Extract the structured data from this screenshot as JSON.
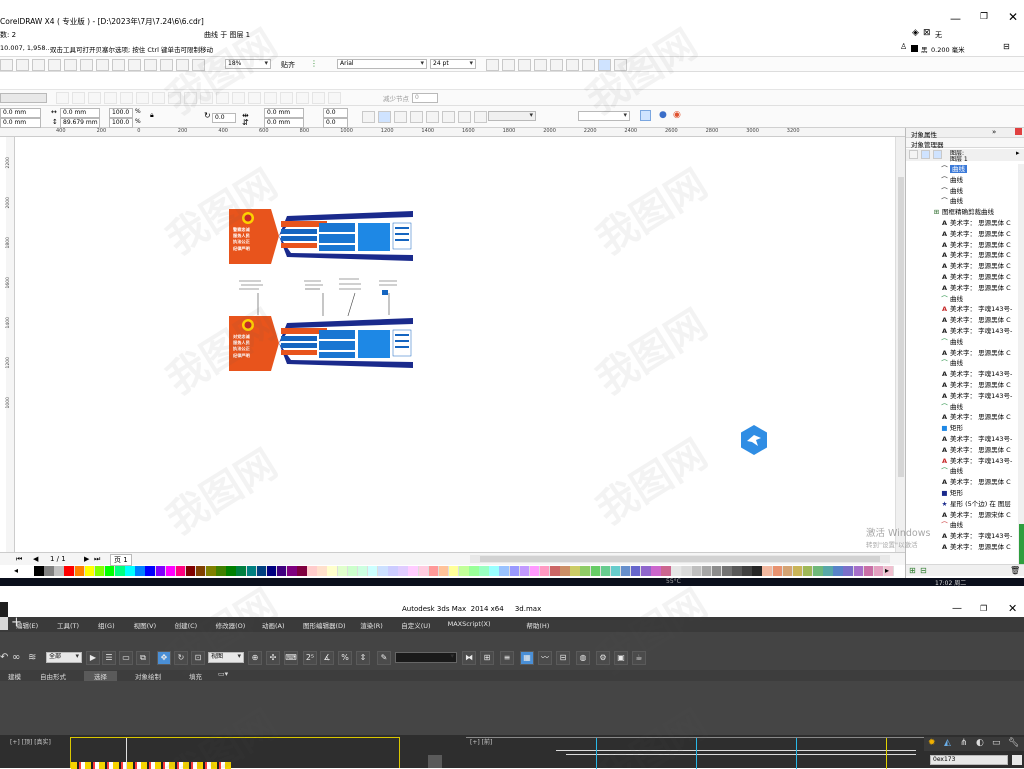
{
  "corel": {
    "title": "CorelDRAW X4 ( 专业版 ) - [D:\\2023年\\7月\\7.24\\6\\6.cdr]",
    "status_top": {
      "count": "数: 2",
      "object": "曲线 于 图层 1",
      "fill_none": "无"
    },
    "hint": {
      "coords": "10.007, 1,958... ",
      "text": "双击工具可打开贝塞尔选项; 按住 Ctrl 键单击可限制移动"
    },
    "outline": {
      "color_name": "黑",
      "width": "0.200 毫米"
    },
    "toolbar": {
      "zoom": "18%",
      "snap": "贴齐",
      "font": "Arial",
      "size": "24 pt"
    },
    "propbar": {
      "x": "0.0 mm",
      "y": "0.0 mm",
      "w": "0.0 mm",
      "h": "89.679 mm",
      "sx": "100.0",
      "sy": "100.0",
      "angle": "0.0",
      "p1": "0.0 mm",
      "p2": "0.0 mm",
      "o1": "0.0",
      "o2": "0.0",
      "reduce_nodes": "减少节点",
      "nodes_value": "0"
    },
    "ruler_ticks": [
      "400",
      "200",
      "0",
      "200",
      "400",
      "600",
      "800",
      "1000",
      "1200",
      "1400",
      "1600",
      "1800",
      "2000",
      "2200",
      "2400",
      "2600",
      "2800",
      "3000",
      "3200"
    ],
    "vruler_ticks": [
      "2200",
      "2000",
      "1800",
      "1600",
      "1400",
      "1200",
      "1000"
    ],
    "page_nav": {
      "counter": "1 / 1",
      "page_tab": "页 1"
    },
    "tray_time": "17:02 周二",
    "tray_temp": "55°C",
    "win_activate": {
      "line1": "激活 Windows",
      "line2": "转到\"设置\"以激活"
    },
    "docker": {
      "tab1": "对象属性",
      "tab2": "对象管理器",
      "layer_page": "图层:",
      "layer1": "图层 1",
      "items": [
        {
          "icon": "curve",
          "label": "曲线",
          "sel": true
        },
        {
          "icon": "curve",
          "label": "曲线"
        },
        {
          "icon": "curve",
          "label": "曲线"
        },
        {
          "icon": "curve",
          "label": "曲线"
        },
        {
          "icon": "clip",
          "label": "图框精确剪裁曲线"
        },
        {
          "icon": "text",
          "label": "美术字： 思源黑体 C"
        },
        {
          "icon": "text",
          "label": "美术字： 思源黑体 C"
        },
        {
          "icon": "text",
          "label": "美术字： 思源黑体 C"
        },
        {
          "icon": "text",
          "label": "美术字： 思源黑体 C"
        },
        {
          "icon": "text",
          "label": "美术字： 思源黑体 C"
        },
        {
          "icon": "text",
          "label": "美术字： 思源黑体 C"
        },
        {
          "icon": "text",
          "label": "美术字： 思源黑体 C"
        },
        {
          "icon": "curve-green",
          "label": "曲线"
        },
        {
          "icon": "text-red",
          "label": "美术字： 字魂143号-"
        },
        {
          "icon": "text",
          "label": "美术字： 思源黑体 C"
        },
        {
          "icon": "text",
          "label": "美术字： 字魂143号-"
        },
        {
          "icon": "curve-green",
          "label": "曲线"
        },
        {
          "icon": "text",
          "label": "美术字： 思源黑体 C"
        },
        {
          "icon": "curve-green",
          "label": "曲线"
        },
        {
          "icon": "text",
          "label": "美术字： 字魂143号-"
        },
        {
          "icon": "text",
          "label": "美术字： 思源黑体 C"
        },
        {
          "icon": "text",
          "label": "美术字： 字魂143号-"
        },
        {
          "icon": "curve-green",
          "label": "曲线"
        },
        {
          "icon": "text",
          "label": "美术字： 思源黑体 C"
        },
        {
          "icon": "rect-blue",
          "label": "矩形"
        },
        {
          "icon": "text",
          "label": "美术字： 字魂143号-"
        },
        {
          "icon": "text",
          "label": "美术字： 思源黑体 C"
        },
        {
          "icon": "text-red",
          "label": "美术字： 字魂143号-"
        },
        {
          "icon": "curve-green",
          "label": "曲线"
        },
        {
          "icon": "text",
          "label": "美术字： 思源黑体 C"
        },
        {
          "icon": "rect-navy",
          "label": "矩形"
        },
        {
          "icon": "star",
          "label": "星形 (5个边) 在 图层"
        },
        {
          "icon": "text",
          "label": "美术字： 思源宋体 C"
        },
        {
          "icon": "curve-red",
          "label": "曲线"
        },
        {
          "icon": "text",
          "label": "美术字： 字魂143号-"
        },
        {
          "icon": "text",
          "label": "美术字： 思源黑体 C"
        }
      ]
    },
    "design": {
      "panel1_text": "警察忠诚\n服务人民\n执法公正\n纪律严明",
      "panel2_text": "对党忠诚\n服务人民\n执法公正\n纪律严明",
      "accent_orange": "#e8541c",
      "accent_blue": "#1565c0",
      "navy": "#1a2a8c"
    },
    "palette": [
      "#ffffff",
      "#000000",
      "#808080",
      "#c0c0c0",
      "#ff0000",
      "#ff8000",
      "#ffff00",
      "#80ff00",
      "#00ff00",
      "#00ff80",
      "#00ffff",
      "#0080ff",
      "#0000ff",
      "#8000ff",
      "#ff00ff",
      "#ff0080",
      "#800000",
      "#804000",
      "#808000",
      "#408000",
      "#008000",
      "#008040",
      "#008080",
      "#004080",
      "#000080",
      "#400080",
      "#800080",
      "#800040",
      "#ffcccc",
      "#ffe0cc",
      "#ffffcc",
      "#e0ffcc",
      "#ccffcc",
      "#ccffe0",
      "#ccffff",
      "#cce0ff",
      "#ccccff",
      "#e0ccff",
      "#ffccff",
      "#ffcce0",
      "#ff9999",
      "#ffc299",
      "#ffff99",
      "#c2ff99",
      "#99ff99",
      "#99ffc2",
      "#99ffff",
      "#99c2ff",
      "#9999ff",
      "#c299ff",
      "#ff99ff",
      "#ff99c2",
      "#cc6666",
      "#cc8f66",
      "#cccc66",
      "#8fcc66",
      "#66cc66",
      "#66cc8f",
      "#66cccc",
      "#668fcc",
      "#6666cc",
      "#8f66cc",
      "#cc66cc",
      "#cc668f",
      "#e6e6e6",
      "#d9d9d9",
      "#bfbfbf",
      "#a6a6a6",
      "#8c8c8c",
      "#737373",
      "#595959",
      "#404040",
      "#262626",
      "#f2b8a0",
      "#e89270",
      "#d4a373",
      "#c9b458",
      "#9fb858",
      "#6fb87a",
      "#58a8a8",
      "#5883c9",
      "#7a6fc9",
      "#a66fc9",
      "#c96fa6",
      "#e3a0c0",
      "#f0c0d0"
    ]
  },
  "max": {
    "title": "Autodesk 3ds Max  2014 x64     3d.max",
    "menu": [
      "编辑(E)",
      "工具(T)",
      "组(G)",
      "视图(V)",
      "创建(C)",
      "修改器(O)",
      "动画(A)",
      "图形编辑器(D)",
      "渲染(R)",
      "自定义(U)",
      "MAXScript(X)",
      "帮助(H)"
    ],
    "select_filter": "全部",
    "view_combo": "视图",
    "named_sel": "",
    "tabs": [
      "建模",
      "自由形式",
      "选择",
      "对象绘制",
      "填充"
    ],
    "active_tab": "选择",
    "viewport1_label": "[+] [顶] [真实]",
    "viewport2_label": "[+] [前] ",
    "coord_field": "0ex173"
  },
  "watermark": "我图网"
}
